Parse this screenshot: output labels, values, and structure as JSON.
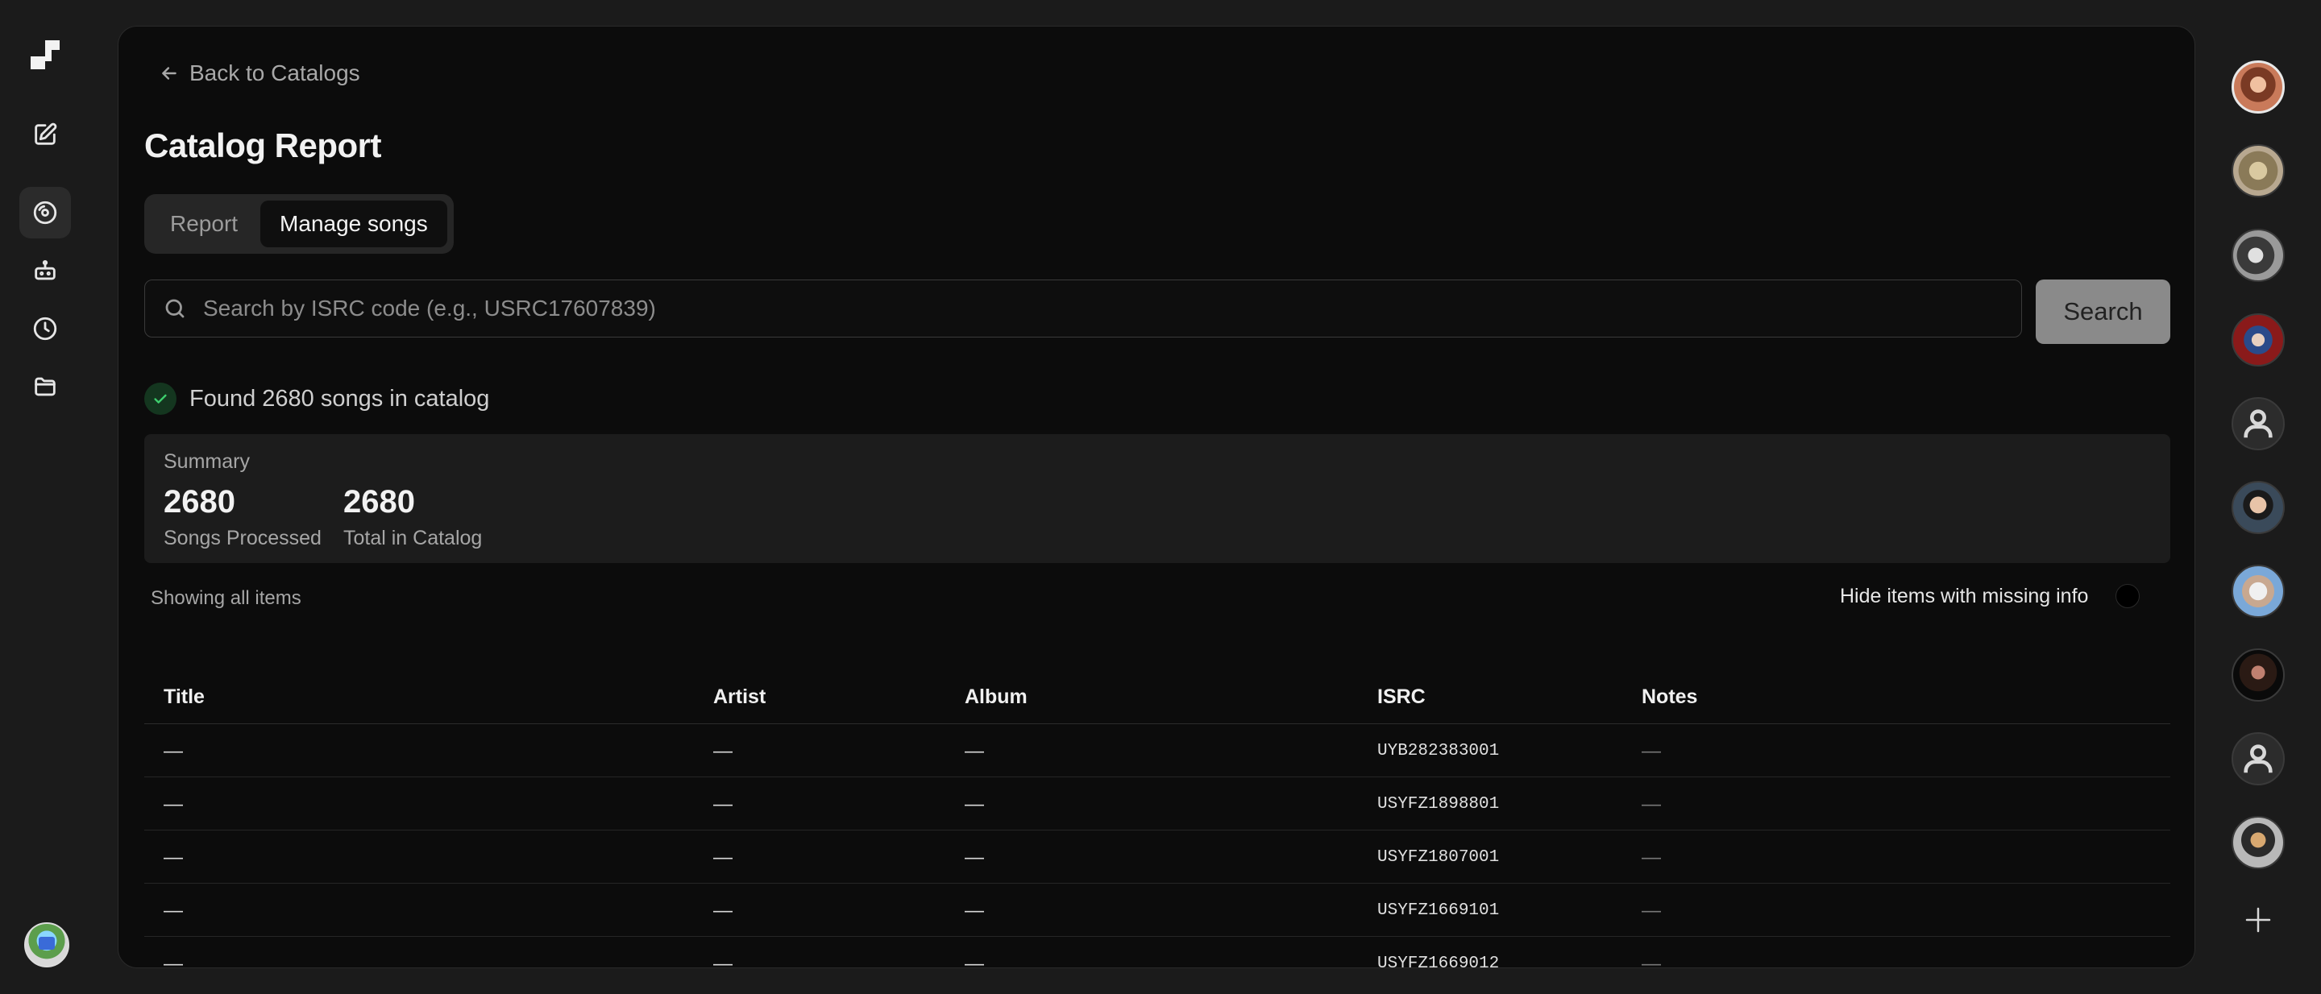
{
  "nav": {
    "logo": "app-logo",
    "items": [
      {
        "name": "edit-icon",
        "active": false
      },
      {
        "name": "catalog-icon",
        "active": true
      },
      {
        "name": "robot-icon",
        "active": false
      },
      {
        "name": "clock-icon",
        "active": false
      },
      {
        "name": "folder-icon",
        "active": false
      }
    ]
  },
  "main": {
    "back_label": "Back to Catalogs",
    "title": "Catalog Report",
    "tabs": [
      {
        "label": "Report",
        "active": false
      },
      {
        "label": "Manage songs",
        "active": true
      }
    ],
    "search": {
      "placeholder": "Search by ISRC code (e.g., USRC17607839)",
      "value": "",
      "button_label": "Search"
    },
    "status_text": "Found 2680 songs in catalog",
    "summary": {
      "label": "Summary",
      "stats": [
        {
          "value": "2680",
          "label": "Songs Processed"
        },
        {
          "value": "2680",
          "label": "Total in Catalog"
        }
      ]
    },
    "filter": {
      "showing_text": "Showing all items",
      "toggle_label": "Hide items with missing info",
      "toggle_on": false
    },
    "table": {
      "columns": [
        "Title",
        "Artist",
        "Album",
        "ISRC",
        "Notes"
      ],
      "rows": [
        {
          "title": "—",
          "artist": "—",
          "album": "—",
          "isrc": "UYB282383001",
          "notes": "—"
        },
        {
          "title": "—",
          "artist": "—",
          "album": "—",
          "isrc": "USYFZ1898801",
          "notes": "—"
        },
        {
          "title": "—",
          "artist": "—",
          "album": "—",
          "isrc": "USYFZ1807001",
          "notes": "—"
        },
        {
          "title": "—",
          "artist": "—",
          "album": "—",
          "isrc": "USYFZ1669101",
          "notes": "—"
        },
        {
          "title": "—",
          "artist": "—",
          "album": "—",
          "isrc": "USYFZ1669012",
          "notes": "—"
        }
      ]
    }
  },
  "colors": {
    "background": "#1b1b1b",
    "panel": "#0c0c0c",
    "success": "#3ecf6e",
    "search_button": "#8a8a8a"
  }
}
